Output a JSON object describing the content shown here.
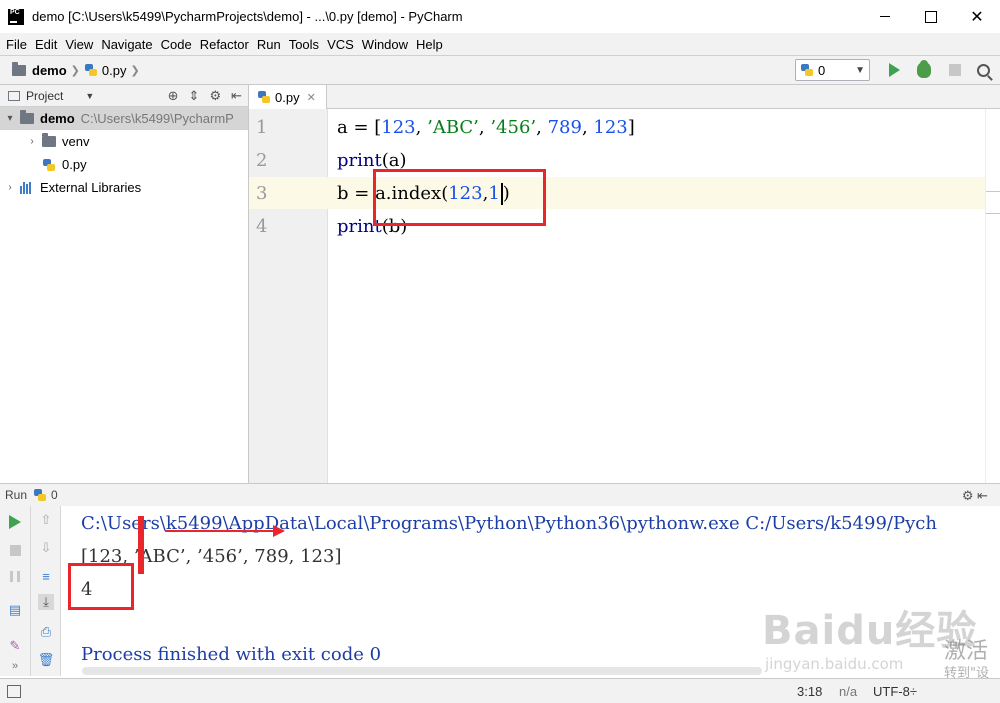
{
  "window": {
    "title": "demo [C:\\Users\\k5499\\PycharmProjects\\demo] - ...\\0.py [demo] - PyCharm",
    "minimize_symbol": "",
    "maximize_symbol": "",
    "close_symbol": "✕"
  },
  "menu": [
    "File",
    "Edit",
    "View",
    "Navigate",
    "Code",
    "Refactor",
    "Run",
    "Tools",
    "VCS",
    "Window",
    "Help"
  ],
  "breadcrumb": {
    "project": "demo",
    "file": "0.py"
  },
  "run_config": {
    "value": "0"
  },
  "project_panel": {
    "title": "Project",
    "tree": [
      {
        "name": "demo",
        "path": "C:\\Users\\k5499\\PycharmP",
        "expanded": true
      },
      {
        "name": "venv"
      },
      {
        "name": "0.py"
      },
      {
        "name": "External Libraries"
      }
    ]
  },
  "editor": {
    "tab_label": "0.py",
    "line_numbers": [
      "1",
      "2",
      "3",
      "4"
    ],
    "lines": {
      "l1": {
        "a": "a = [",
        "n1": "123",
        "c1": ", ",
        "s1": "’ABC’",
        "c2": ", ",
        "s2": "’456’",
        "c3": ", ",
        "n2": "789",
        "c4": ", ",
        "n3": "123",
        "end": "]"
      },
      "l2": {
        "fn": "print",
        "arg": "(a)"
      },
      "l3": {
        "pre": "b = ",
        "call": "a.index(",
        "n1": "123",
        "comma": ",",
        "n2": "1",
        "close": ")"
      },
      "l4": {
        "fn": "print",
        "arg": "(b)"
      }
    }
  },
  "run_panel": {
    "label": "Run",
    "config": "0",
    "console": {
      "command": "C:\\Users\\k5499\\AppData\\Local\\Programs\\Python\\Python36\\pythonw.exe C:/Users/k5499/Pych",
      "output_list": "[123, ’ABC’, ’456’, 789, 123]",
      "output_index": "4",
      "exit_message": "Process finished with exit code 0"
    }
  },
  "status_bar": {
    "position": "3:18",
    "separator": "n/a",
    "encoding": "UTF-8÷"
  },
  "watermark": {
    "logo": "Baidu经验",
    "url": "jingyan.baidu.com",
    "activate": "激活",
    "activate_sub": "转到\"设"
  },
  "colors": {
    "number": "#1750eb",
    "string": "#067d17",
    "annotation": "#e8262b",
    "console_text": "#1c3ea5"
  }
}
